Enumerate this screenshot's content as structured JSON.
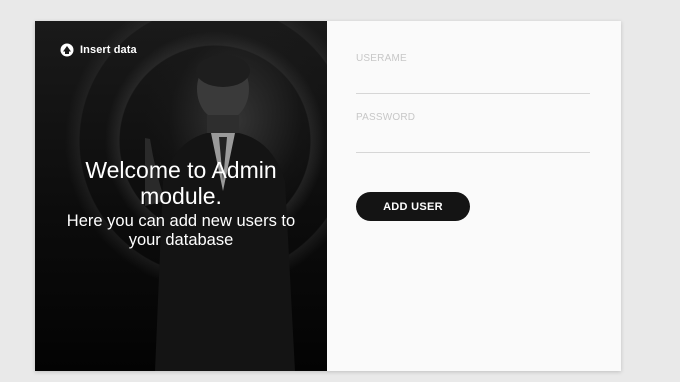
{
  "brand": {
    "icon": "logo-emblem-icon",
    "label": "Insert data"
  },
  "welcome": {
    "title": "Welcome to Admin module.",
    "subtitle": "Here you can add new users to your database"
  },
  "form": {
    "username": {
      "label": "USERAME",
      "value": "",
      "placeholder": ""
    },
    "password": {
      "label": "PASSWORD",
      "value": "",
      "placeholder": ""
    },
    "submit_label": "ADD USER"
  },
  "colors": {
    "page_background": "#e9e9e9",
    "card_background": "#fafafa",
    "button_background": "#141414",
    "label_color": "#c7c7c7"
  }
}
